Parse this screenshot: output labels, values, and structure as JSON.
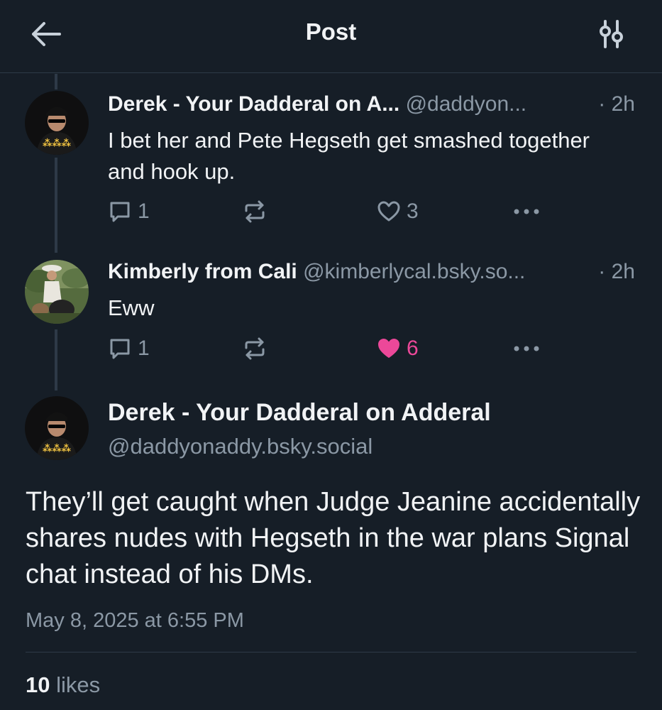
{
  "header": {
    "title": "Post",
    "back_icon": "arrow-left-icon",
    "settings_icon": "sliders-icon"
  },
  "replies": [
    {
      "author_name": "Derek - Your Dadderal on A...",
      "author_handle": "@daddyon...",
      "time": "· 2h",
      "text": "I bet her and Pete Hegseth get smashed together and hook up.",
      "reply_count": "1",
      "like_count": "3",
      "liked": false
    },
    {
      "author_name": "Kimberly from Cali",
      "author_handle": "@kimberlycal.bsky.so...",
      "time": "· 2h",
      "text": "Eww",
      "reply_count": "1",
      "like_count": "6",
      "liked": true
    }
  ],
  "main_post": {
    "author_name": "Derek - Your Dadderal on Adderal",
    "author_handle": "@daddyonaddy.bsky.social",
    "text": "They’ll get caught when Judge Jeanine accidentally shares nudes with Hegseth in the war plans Signal chat instead of his DMs.",
    "date": "May 8, 2025 at 6:55 PM",
    "likes_count": "10",
    "likes_label": "likes"
  },
  "colors": {
    "background": "#161e27",
    "text": "#f1f3f5",
    "muted": "#8b98a5",
    "like_pink": "#ec4899",
    "divider": "#2e3a47"
  }
}
